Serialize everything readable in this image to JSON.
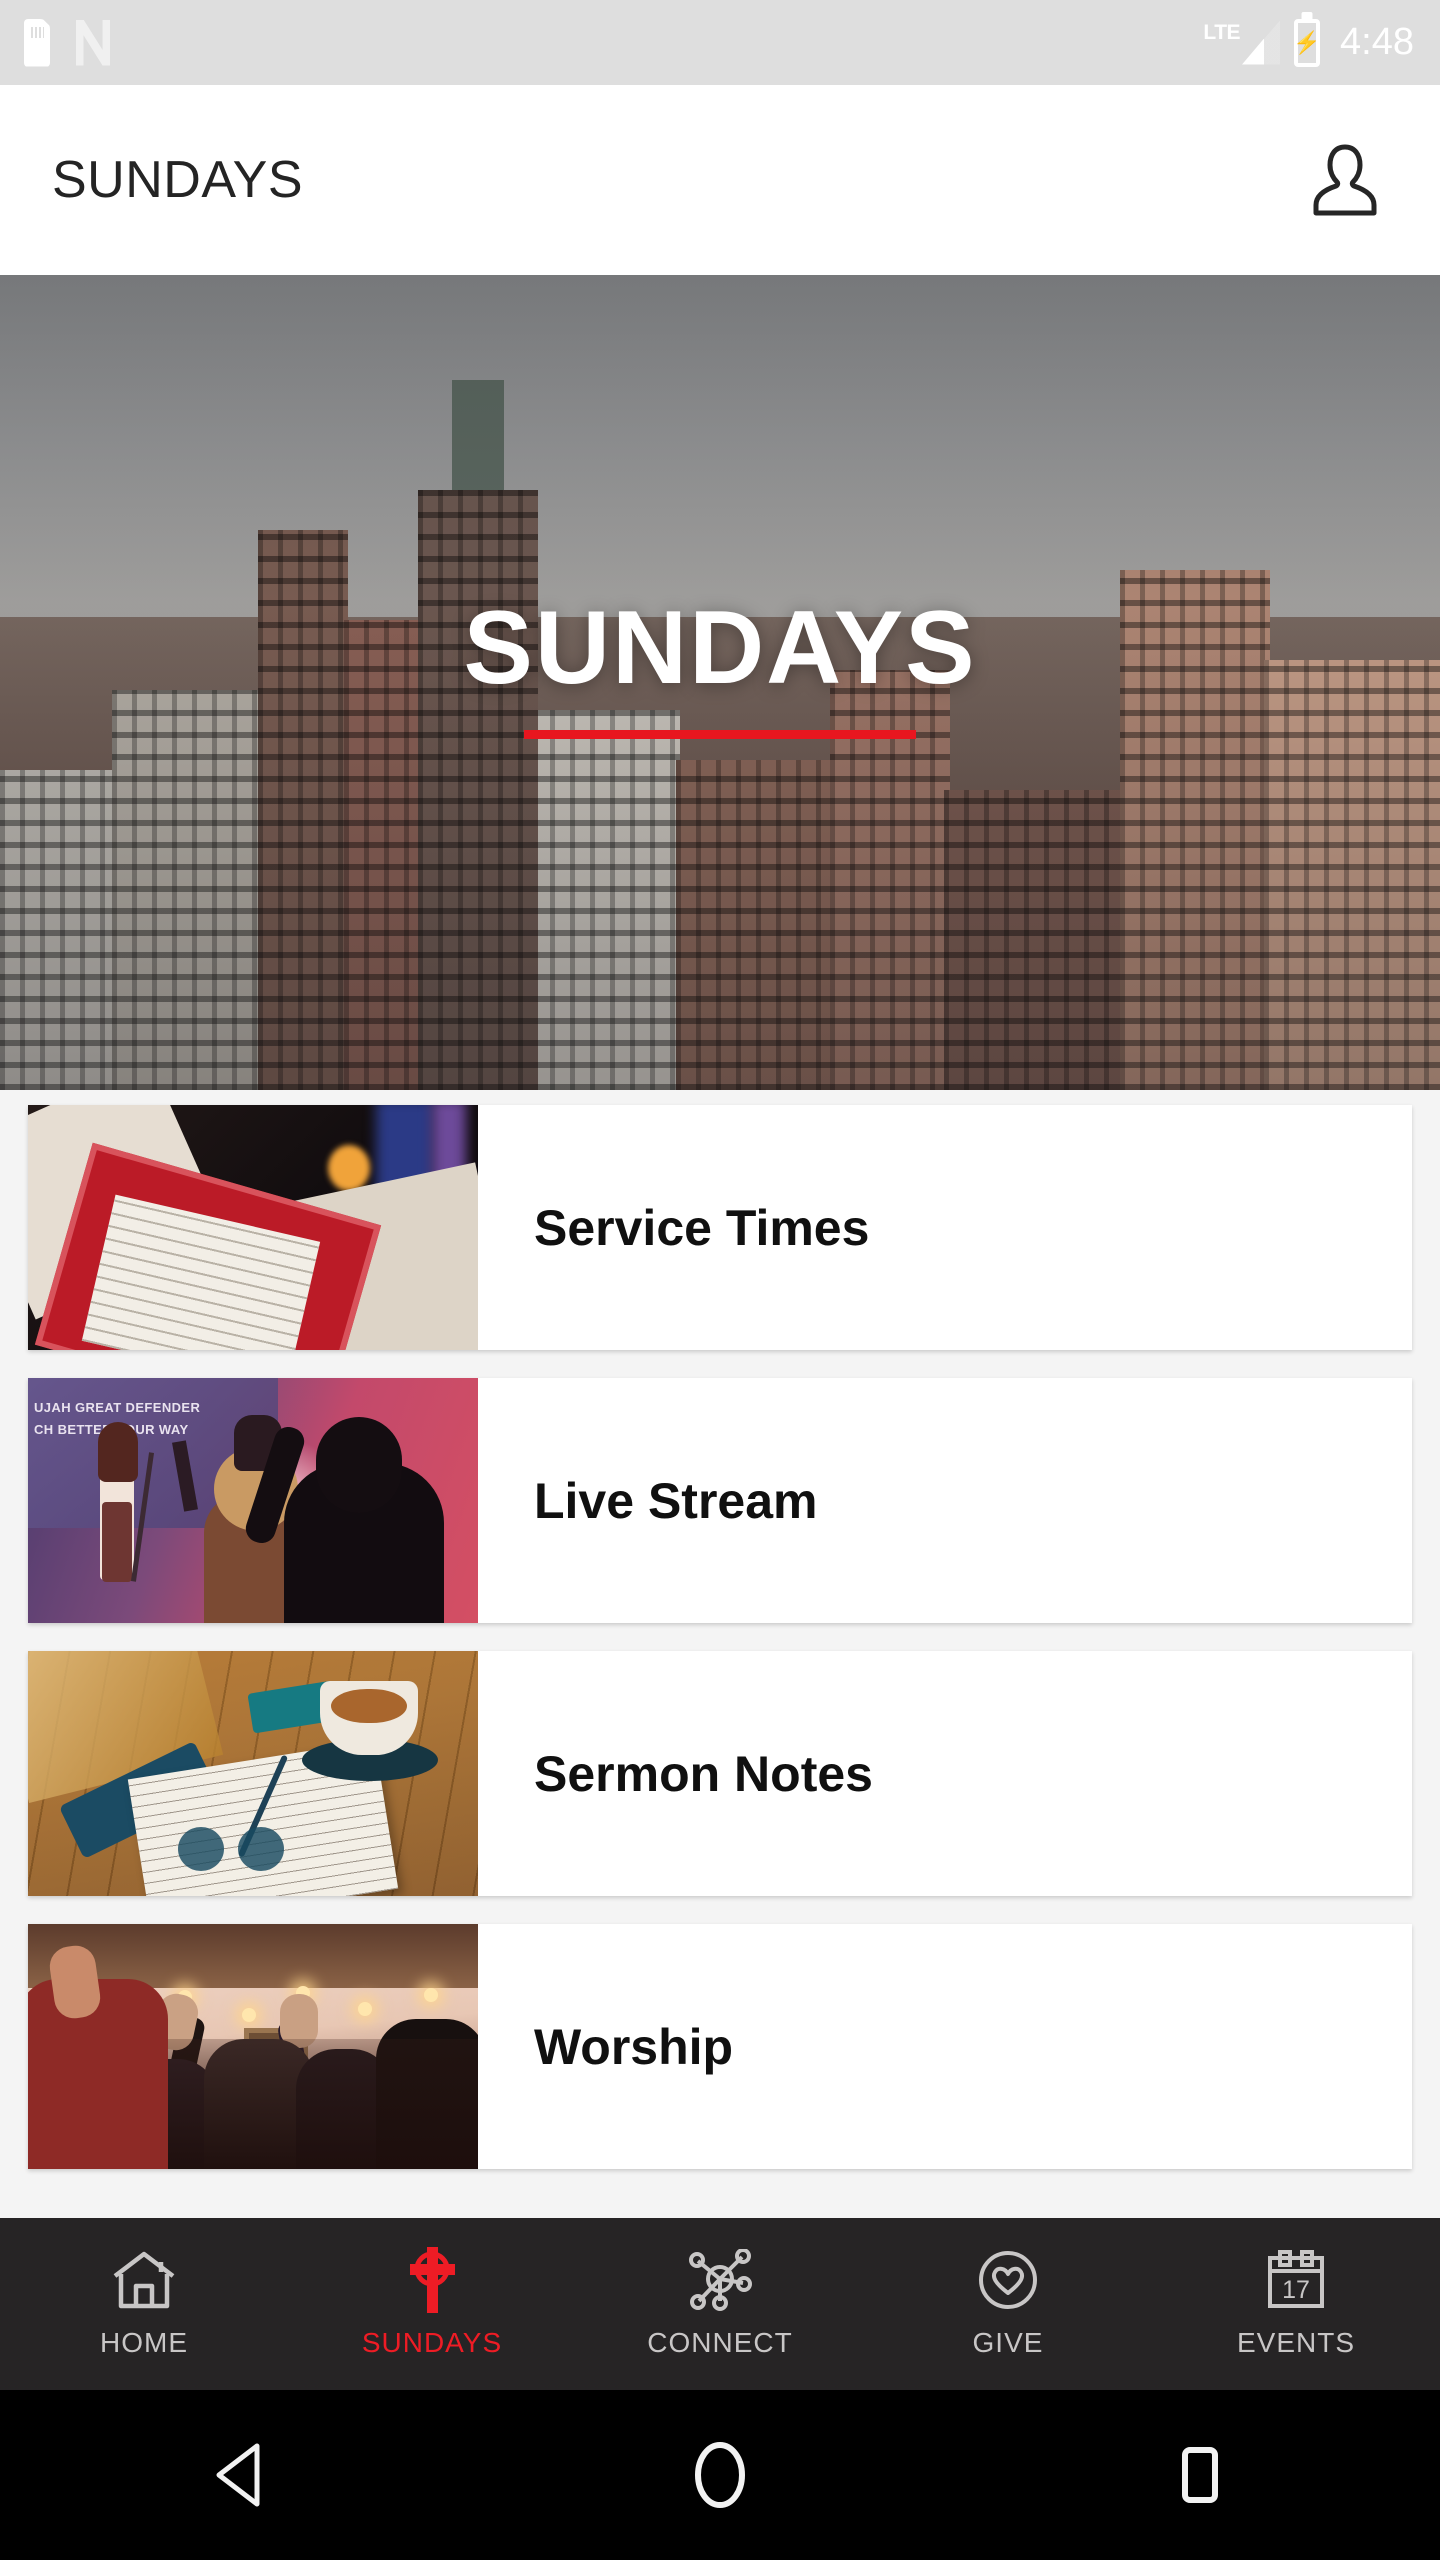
{
  "status_bar": {
    "time": "4:48",
    "network_label": "LTE",
    "icons": [
      "sd-card-icon",
      "nfc-icon",
      "lte-signal-icon",
      "battery-charging-icon"
    ]
  },
  "header": {
    "title": "SUNDAYS",
    "profile_icon": "person-icon"
  },
  "hero": {
    "title": "SUNDAYS",
    "accent_color": "#e8161f",
    "image_description": "city skyline"
  },
  "cards": [
    {
      "title": "Service Times",
      "thumb": "sheet-music-thumbnail"
    },
    {
      "title": "Live Stream",
      "thumb": "worship-concert-thumbnail",
      "overlay_text_line1": "UJAH GREAT DEFENDER",
      "overlay_text_line2": "CH BETTER YOUR WAY"
    },
    {
      "title": "Sermon Notes",
      "thumb": "notebook-coffee-thumbnail"
    },
    {
      "title": "Worship",
      "thumb": "congregation-hands-thumbnail"
    }
  ],
  "tabs": [
    {
      "label": "HOME",
      "icon": "house-icon",
      "active": false
    },
    {
      "label": "SUNDAYS",
      "icon": "cross-icon",
      "active": true
    },
    {
      "label": "CONNECT",
      "icon": "network-icon",
      "active": false
    },
    {
      "label": "GIVE",
      "icon": "heart-circle-icon",
      "active": false
    },
    {
      "label": "EVENTS",
      "icon": "calendar-icon",
      "active": false,
      "icon_day": "17"
    }
  ],
  "android_nav": {
    "back": "back-triangle-icon",
    "home": "home-circle-icon",
    "recents": "recents-square-icon"
  },
  "colors": {
    "accent_red": "#ee1c25",
    "tabbar_bg": "#262425",
    "page_bg": "#f4f4f4",
    "statusbar_bg": "#dedede"
  }
}
